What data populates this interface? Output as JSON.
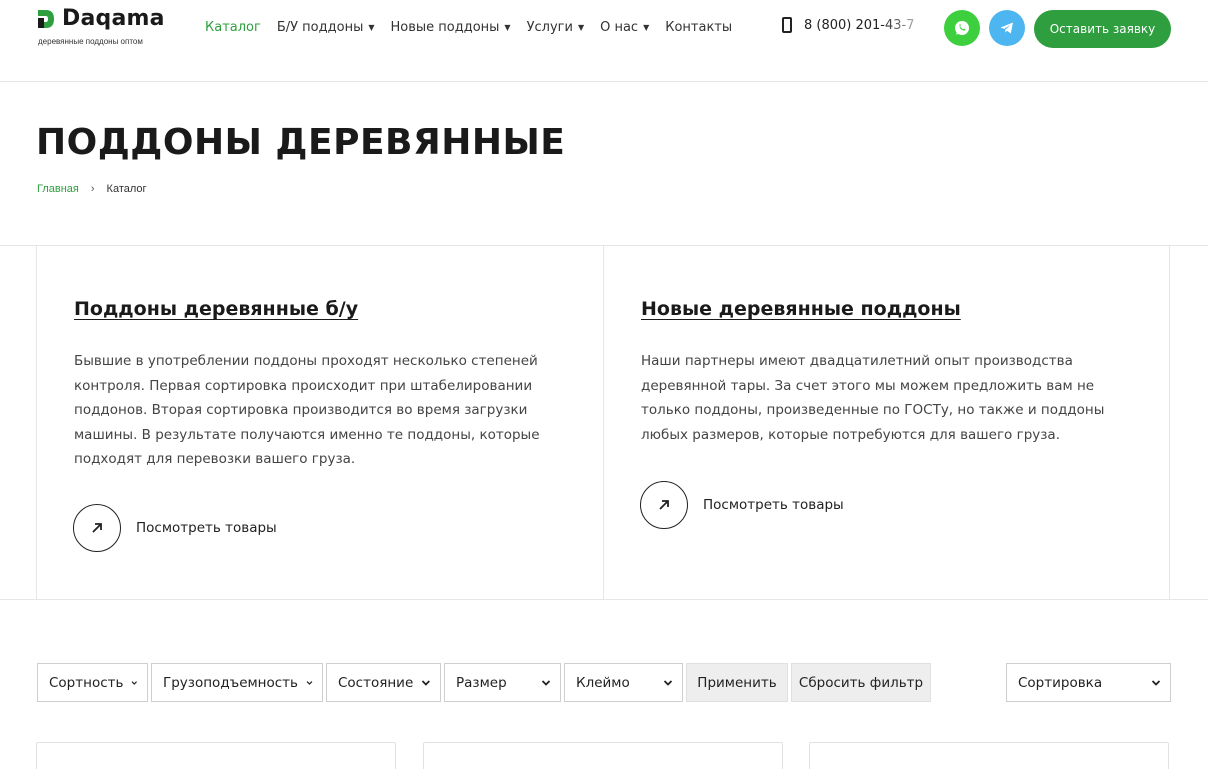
{
  "header": {
    "logo": {
      "name": "Daqama",
      "tagline": "деревянные поддоны оптом"
    },
    "nav": [
      {
        "label": "Каталог",
        "has_dropdown": false,
        "active": true
      },
      {
        "label": "Б/У поддоны",
        "has_dropdown": true,
        "active": false
      },
      {
        "label": "Новые поддоны",
        "has_dropdown": true,
        "active": false
      },
      {
        "label": "Услуги",
        "has_dropdown": true,
        "active": false
      },
      {
        "label": "О нас",
        "has_dropdown": true,
        "active": false
      },
      {
        "label": "Контакты",
        "has_dropdown": false,
        "active": false
      }
    ],
    "phone": "8 (800) 201-43-7",
    "social": [
      {
        "icon": "whatsapp-icon",
        "color": "#3ecf3e"
      },
      {
        "icon": "telegram-icon",
        "color": "#4db5f0"
      }
    ],
    "cta_label": "Оставить заявку"
  },
  "page": {
    "title": "ПОДДОНЫ ДЕРЕВЯННЫЕ",
    "breadcrumb": {
      "home": "Главная",
      "separator": "›",
      "current": "Каталог"
    }
  },
  "categories": [
    {
      "title": "Поддоны деревянные б/у",
      "description": "Бывшие в употреблении поддоны проходят несколько степеней контроля. Первая сортировка происходит при штабелировании поддонов. Вторая сортировка производится во время загрузки машины. В результате получаются именно те поддоны, которые подходят для перевозки вашего груза.",
      "more_label": "Посмотреть товары"
    },
    {
      "title": "Новые деревянные поддоны",
      "description": "Наши партнеры имеют двадцатилетний опыт производства деревянной тары. За счет этого мы можем предложить вам не только поддоны, произведенные по ГОСТу, но также и поддоны любых размеров, которые потребуются для вашего груза.",
      "more_label": "Посмотреть товары"
    }
  ],
  "filters": {
    "selects": [
      "Сортность",
      "Грузоподъемность",
      "Состояние",
      "Размер",
      "Клеймо"
    ],
    "apply_label": "Применить",
    "reset_label": "Сбросить фильтр",
    "sort_label": "Сортировка"
  },
  "colors": {
    "accent": "#2e9e3e",
    "whatsapp": "#3ecf3e",
    "telegram": "#4db5f0",
    "border": "#e6e6e6"
  }
}
